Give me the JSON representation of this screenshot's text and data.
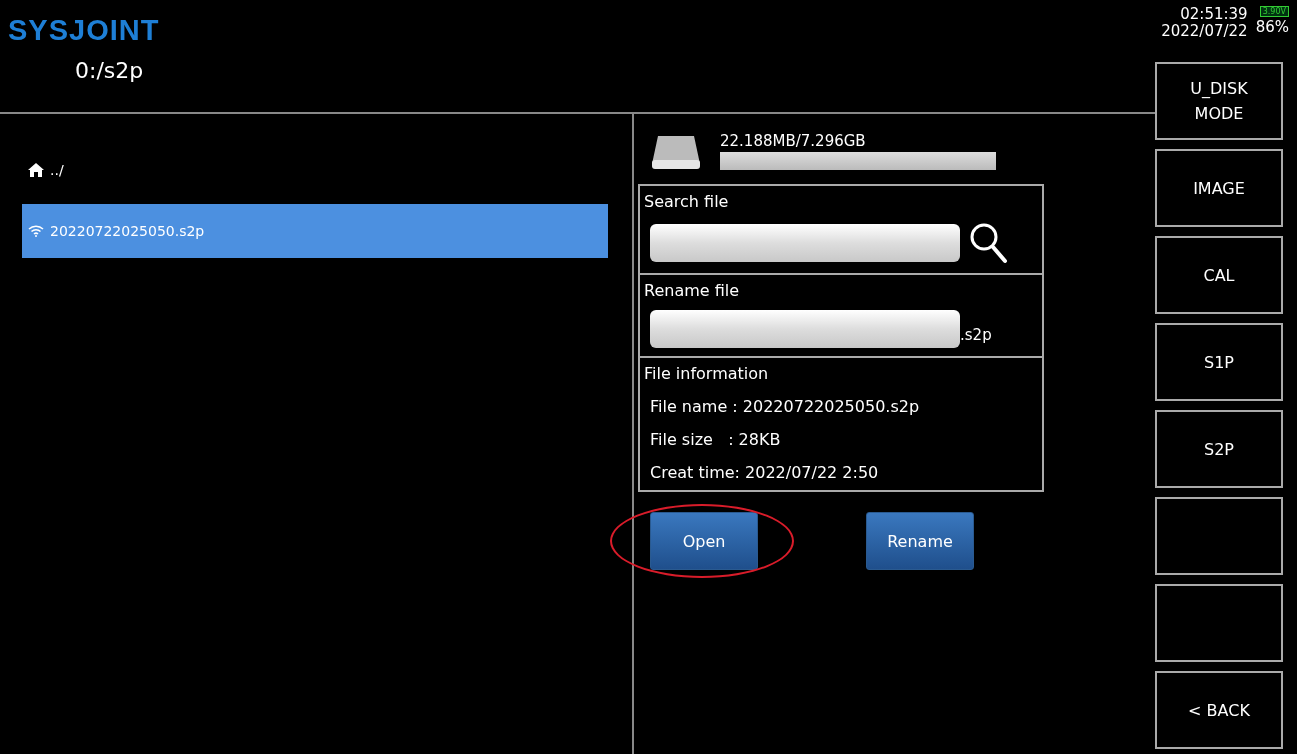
{
  "header": {
    "logo": "SYSJOINT",
    "path": "0:/s2p",
    "time": "02:51:39",
    "date": "2022/07/22",
    "battery_voltage": "3.90V",
    "battery_percent": "86%"
  },
  "file_list": [
    {
      "kind": "parent",
      "label": "../",
      "selected": false
    },
    {
      "kind": "file",
      "label": "20220722025050.s2p",
      "selected": true
    }
  ],
  "storage": {
    "capacity": "22.188MB/7.296GB"
  },
  "search": {
    "title": "Search file"
  },
  "rename": {
    "title": "Rename file",
    "extension": ".s2p"
  },
  "file_info": {
    "title": "File information",
    "lines": [
      "File name : 20220722025050.s2p",
      "File size   : 28KB",
      "Creat time: 2022/07/22 2:50"
    ]
  },
  "actions": [
    {
      "label": "Open",
      "highlighted": true
    },
    {
      "label": "Rename",
      "highlighted": false
    }
  ],
  "softkeys": [
    {
      "kind": "label",
      "lines": [
        "U_DISK",
        "MODE"
      ]
    },
    {
      "kind": "label",
      "lines": [
        "IMAGE"
      ]
    },
    {
      "kind": "label",
      "lines": [
        "CAL"
      ]
    },
    {
      "kind": "label",
      "lines": [
        "S1P"
      ]
    },
    {
      "kind": "label",
      "lines": [
        "S2P"
      ]
    },
    {
      "kind": "blank"
    },
    {
      "kind": "blank"
    },
    {
      "kind": "label",
      "lines": [
        "< BACK"
      ]
    }
  ]
}
